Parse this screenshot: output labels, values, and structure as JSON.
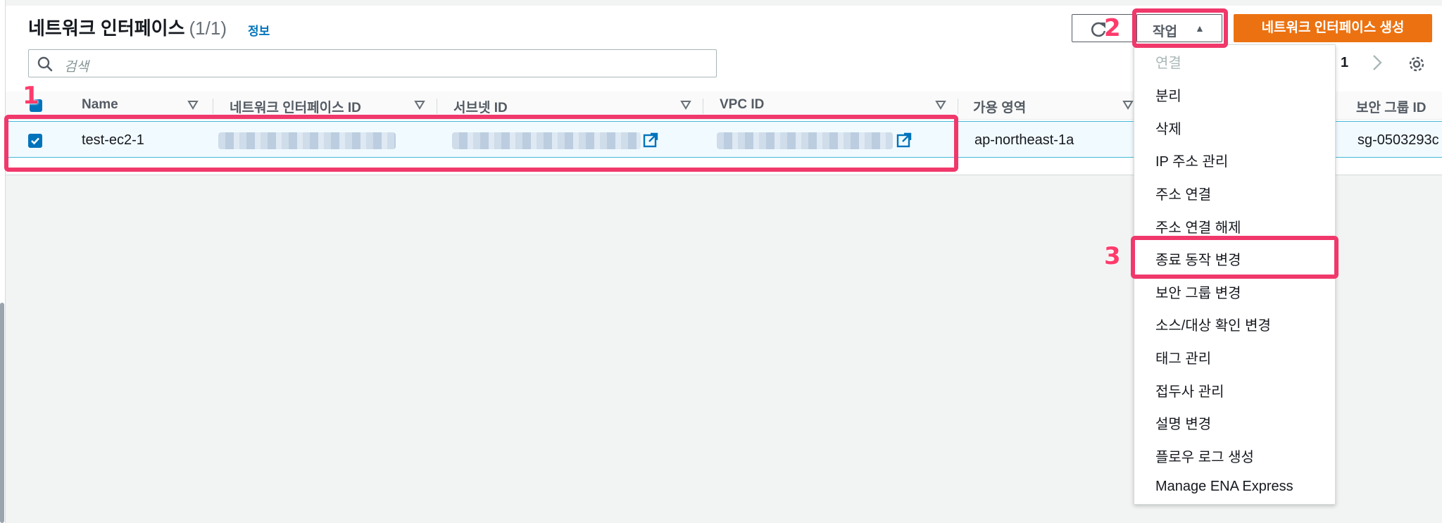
{
  "header": {
    "title": "네트워크 인터페이스",
    "count": "(1/1)",
    "info_link": "정보"
  },
  "search": {
    "placeholder": "검색"
  },
  "toolbar": {
    "actions_label": "작업",
    "create_label": "네트워크 인터페이스 생성"
  },
  "pagination": {
    "current_page": "1"
  },
  "table": {
    "columns": [
      "Name",
      "네트워크 인터페이스 ID",
      "서브넷 ID",
      "VPC ID",
      "가용 영역",
      "보안 그룹 ID"
    ],
    "rows": [
      {
        "name": "test-ec2-1",
        "availability_zone": "ap-northeast-1a",
        "security_group": "sg-0503293c",
        "selected": true
      }
    ]
  },
  "actions_menu": {
    "items": [
      {
        "label": "연결",
        "disabled": true
      },
      {
        "label": "분리"
      },
      {
        "label": "삭제"
      },
      {
        "label": "IP 주소 관리"
      },
      {
        "label": "주소 연결"
      },
      {
        "label": "주소 연결 해제"
      },
      {
        "label": "종료 동작 변경"
      },
      {
        "label": "보안 그룹 변경"
      },
      {
        "label": "소스/대상 확인 변경"
      },
      {
        "label": "태그 관리"
      },
      {
        "label": "접두사 관리"
      },
      {
        "label": "설명 변경"
      },
      {
        "label": "플로우 로그 생성"
      },
      {
        "label": "Manage ENA Express"
      }
    ]
  },
  "annotations": {
    "step1": "1",
    "step2": "2",
    "step3": "3"
  },
  "colors": {
    "primary": "#ec7211",
    "link": "#0073bb",
    "highlight": "#f0386b"
  }
}
